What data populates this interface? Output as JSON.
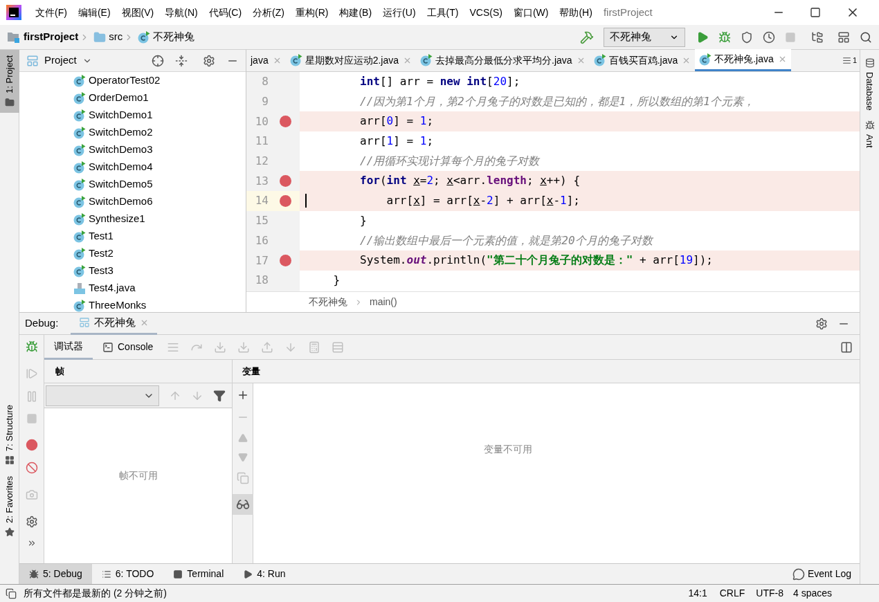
{
  "window": {
    "title": "firstProject",
    "menu": [
      "文件(F)",
      "编辑(E)",
      "视图(V)",
      "导航(N)",
      "代码(C)",
      "分析(Z)",
      "重构(R)",
      "构建(B)",
      "运行(U)",
      "工具(T)",
      "VCS(S)",
      "窗口(W)",
      "帮助(H)"
    ]
  },
  "nav_bar": {
    "breadcrumbs": [
      {
        "kind": "project",
        "label": "firstProject"
      },
      {
        "kind": "folder",
        "label": "src"
      },
      {
        "kind": "class",
        "label": "不死神兔"
      }
    ],
    "run_config": "不死神兔"
  },
  "left_stripe": [
    {
      "label": "1: Project",
      "selected": true,
      "kind": "project"
    },
    {
      "label": "7: Structure",
      "selected": false,
      "kind": "structure"
    },
    {
      "label": "2: Favorites",
      "selected": false,
      "kind": "favorites"
    }
  ],
  "right_stripe": [
    {
      "label": "Database",
      "kind": "database"
    },
    {
      "label": "Ant",
      "kind": "ant"
    }
  ],
  "project_panel": {
    "title": "Project",
    "items": [
      {
        "kind": "class",
        "label": "OperatorTest02"
      },
      {
        "kind": "class",
        "label": "OrderDemo1"
      },
      {
        "kind": "class",
        "label": "SwitchDemo1"
      },
      {
        "kind": "class",
        "label": "SwitchDemo2"
      },
      {
        "kind": "class",
        "label": "SwitchDemo3"
      },
      {
        "kind": "class",
        "label": "SwitchDemo4"
      },
      {
        "kind": "class",
        "label": "SwitchDemo5"
      },
      {
        "kind": "class",
        "label": "SwitchDemo6"
      },
      {
        "kind": "class",
        "label": "Synthesize1"
      },
      {
        "kind": "class",
        "label": "Test1"
      },
      {
        "kind": "class",
        "label": "Test2"
      },
      {
        "kind": "class",
        "label": "Test3"
      },
      {
        "kind": "file",
        "label": "Test4.java"
      },
      {
        "kind": "class",
        "label": "ThreeMonks"
      }
    ]
  },
  "editor": {
    "tabs": [
      {
        "label": "java",
        "kind": "cut",
        "selected": false
      },
      {
        "label": "星期数对应运动2.java",
        "kind": "class",
        "selected": false
      },
      {
        "label": "去掉最高分最低分求平均分.java",
        "kind": "class",
        "selected": false
      },
      {
        "label": "百钱买百鸡.java",
        "kind": "class",
        "selected": false
      },
      {
        "label": "不死神兔.java",
        "kind": "class",
        "selected": true
      }
    ],
    "tab_count": "1",
    "lines": [
      {
        "number": "8",
        "breakpoint": false,
        "current": false,
        "tokens": [
          {
            "kind": "kw",
            "text": "        int"
          },
          {
            "kind": "plain",
            "text": "[] arr = "
          },
          {
            "kind": "kw",
            "text": "new "
          },
          {
            "kind": "kw",
            "text": "int"
          },
          {
            "kind": "plain",
            "text": "["
          },
          {
            "kind": "num",
            "text": "20"
          },
          {
            "kind": "plain",
            "text": "];"
          }
        ]
      },
      {
        "number": "9",
        "breakpoint": false,
        "current": false,
        "tokens": [
          {
            "kind": "comment",
            "text": "        //因为第1个月，第2个月兔子的对数是已知的，都是1，所以数组的第1个元素，"
          }
        ]
      },
      {
        "number": "10",
        "breakpoint": true,
        "current": false,
        "tokens": [
          {
            "kind": "plain",
            "text": "        arr["
          },
          {
            "kind": "num",
            "text": "0"
          },
          {
            "kind": "plain",
            "text": "] = "
          },
          {
            "kind": "num",
            "text": "1"
          },
          {
            "kind": "plain",
            "text": ";"
          }
        ]
      },
      {
        "number": "11",
        "breakpoint": false,
        "current": false,
        "tokens": [
          {
            "kind": "plain",
            "text": "        arr["
          },
          {
            "kind": "num",
            "text": "1"
          },
          {
            "kind": "plain",
            "text": "] = "
          },
          {
            "kind": "num",
            "text": "1"
          },
          {
            "kind": "plain",
            "text": ";"
          }
        ]
      },
      {
        "number": "12",
        "breakpoint": false,
        "current": false,
        "tokens": [
          {
            "kind": "comment",
            "text": "        //用循环实现计算每个月的兔子对数"
          }
        ]
      },
      {
        "number": "13",
        "breakpoint": true,
        "current": false,
        "tokens": [
          {
            "kind": "kw",
            "text": "        for"
          },
          {
            "kind": "plain",
            "text": "("
          },
          {
            "kind": "kw",
            "text": "int "
          },
          {
            "kind": "var",
            "text": "x"
          },
          {
            "kind": "plain",
            "text": "="
          },
          {
            "kind": "num",
            "text": "2"
          },
          {
            "kind": "plain",
            "text": "; "
          },
          {
            "kind": "var",
            "text": "x"
          },
          {
            "kind": "plain",
            "text": "<arr."
          },
          {
            "kind": "field",
            "text": "length"
          },
          {
            "kind": "plain",
            "text": "; "
          },
          {
            "kind": "var",
            "text": "x"
          },
          {
            "kind": "plain",
            "text": "++) {"
          }
        ]
      },
      {
        "number": "14",
        "breakpoint": true,
        "current": true,
        "tokens": [
          {
            "kind": "plain",
            "text": "            arr["
          },
          {
            "kind": "var",
            "text": "x"
          },
          {
            "kind": "plain",
            "text": "] = arr["
          },
          {
            "kind": "var",
            "text": "x"
          },
          {
            "kind": "plain",
            "text": "-"
          },
          {
            "kind": "num",
            "text": "2"
          },
          {
            "kind": "plain",
            "text": "] + arr["
          },
          {
            "kind": "var",
            "text": "x"
          },
          {
            "kind": "plain",
            "text": "-"
          },
          {
            "kind": "num",
            "text": "1"
          },
          {
            "kind": "plain",
            "text": "];"
          }
        ]
      },
      {
        "number": "15",
        "breakpoint": false,
        "current": false,
        "tokens": [
          {
            "kind": "plain",
            "text": "        }"
          }
        ]
      },
      {
        "number": "16",
        "breakpoint": false,
        "current": false,
        "tokens": [
          {
            "kind": "comment",
            "text": "        //输出数组中最后一个元素的值，就是第20个月的兔子对数"
          }
        ]
      },
      {
        "number": "17",
        "breakpoint": true,
        "current": false,
        "tokens": [
          {
            "kind": "plain",
            "text": "        System."
          },
          {
            "kind": "static",
            "text": "out"
          },
          {
            "kind": "plain",
            "text": ".println("
          },
          {
            "kind": "string",
            "text": "\"第二十个月兔子的对数是：\""
          },
          {
            "kind": "plain",
            "text": " + arr["
          },
          {
            "kind": "num",
            "text": "19"
          },
          {
            "kind": "plain",
            "text": "]);"
          }
        ]
      },
      {
        "number": "18",
        "breakpoint": false,
        "current": false,
        "tokens": [
          {
            "kind": "plain",
            "text": "    }"
          }
        ]
      }
    ],
    "breadcrumbs": [
      "不死神兔",
      "main()"
    ]
  },
  "debug": {
    "label": "Debug:",
    "session_tab": "不死神兔",
    "tabs": [
      {
        "label": "调试器",
        "selected": true,
        "kind": "debugger"
      },
      {
        "label": "Console",
        "selected": false,
        "kind": "console"
      }
    ],
    "frames": {
      "title": "帧",
      "empty": "帧不可用"
    },
    "variables": {
      "title": "变量",
      "empty": "变量不可用"
    }
  },
  "bottom_tabs": [
    {
      "label": "5: Debug",
      "kind": "debug",
      "selected": true
    },
    {
      "label": "6: TODO",
      "kind": "todo",
      "selected": false
    },
    {
      "label": "Terminal",
      "kind": "terminal",
      "selected": false
    },
    {
      "label": "4: Run",
      "kind": "run",
      "selected": false
    }
  ],
  "event_log": "Event Log",
  "status_bar": {
    "message": "所有文件都是最新的 (2 分钟之前)",
    "position": "14:1",
    "line_separator": "CRLF",
    "encoding": "UTF-8",
    "indent": "4 spaces"
  }
}
